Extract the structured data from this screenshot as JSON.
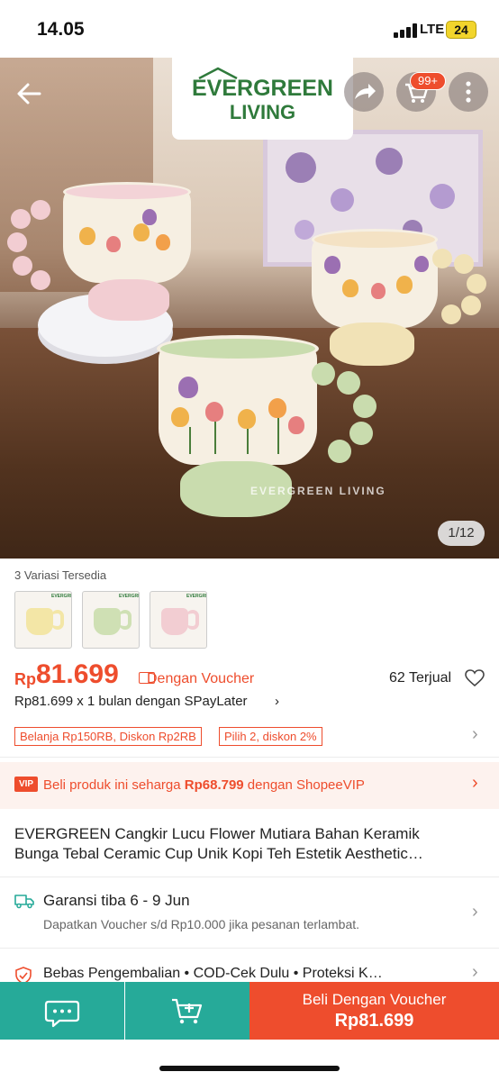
{
  "status_bar": {
    "time": "14.05",
    "network": "LTE",
    "battery": "24"
  },
  "hero": {
    "brand_line1": "EVERGREEN",
    "brand_line2": "LIVING",
    "cart_badge": "99+",
    "watermark": "EVERGREEN LIVING",
    "image_counter": "1/12"
  },
  "variants": {
    "label": "3 Variasi Tersedia",
    "items": [
      {
        "color": "#f3e6a6"
      },
      {
        "color": "#cfe0b4"
      },
      {
        "color": "#f2cdd2"
      }
    ]
  },
  "price": {
    "currency": "Rp",
    "value": "81.699",
    "voucher_label": "Dengan Voucher",
    "sold": "62 Terjual",
    "spaylater": "Rp81.699 x 1 bulan dengan SPayLater",
    "chevron": "›"
  },
  "promos": [
    "Belanja Rp150RB, Diskon Rp2RB",
    "Pilih 2, diskon 2%"
  ],
  "vip": {
    "badge": "VIP",
    "text_before": "Beli produk ini seharga ",
    "price": "Rp68.799",
    "text_after": " dengan ShopeeVIP"
  },
  "product": {
    "title_line1": "EVERGREEN Cangkir Lucu Flower Mutiara Bahan Keramik",
    "title_line2": "Bunga Tebal Ceramic Cup Unik Kopi Teh Estetik Aesthetic…"
  },
  "shipping": {
    "title": "Garansi tiba 6 - 9 Jun",
    "subtitle": "Dapatkan Voucher s/d Rp10.000 jika pesanan terlambat."
  },
  "benefits": "Bebas Pengembalian  •  COD-Cek Dulu  •  Proteksi K…",
  "bottom_bar": {
    "buy_label": "Beli Dengan Voucher",
    "buy_price": "Rp81.699"
  },
  "colors": {
    "accent": "#ee4d2d",
    "teal": "#26aa99",
    "brand_green": "#2f7a3b"
  }
}
